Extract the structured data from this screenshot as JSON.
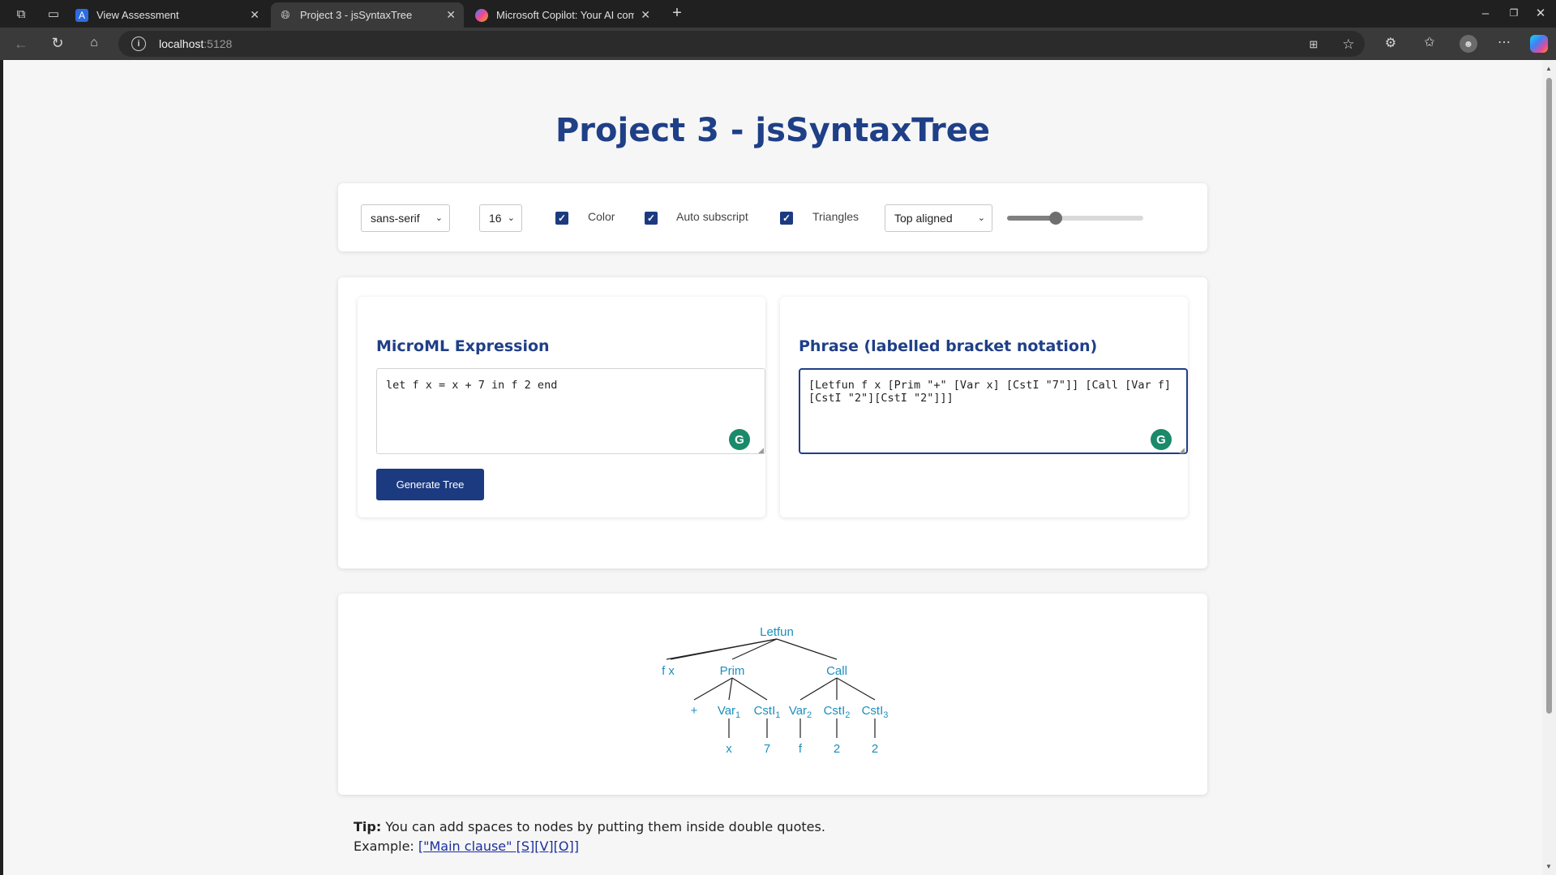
{
  "browser": {
    "tabs": [
      {
        "title": "View Assessment",
        "icon": "assessment-favicon"
      },
      {
        "title": "Project 3 - jsSyntaxTree",
        "icon": "globe-icon"
      },
      {
        "title": "Microsoft Copilot: Your AI com",
        "icon": "copilot-favicon"
      }
    ],
    "address": {
      "host": "localhost",
      "port": ":5128"
    }
  },
  "page": {
    "title": "Project 3 - jsSyntaxTree",
    "options": {
      "font_family": "sans-serif",
      "font_size": "16",
      "color_label": "Color",
      "color_checked": true,
      "auto_subscript_label": "Auto subscript",
      "auto_subscript_checked": true,
      "triangles_label": "Triangles",
      "triangles_checked": true,
      "alignment": "Top aligned",
      "slider_value": 0.36
    },
    "microml": {
      "title": "MicroML Expression",
      "value": "let f x = x + 7 in f 2 end",
      "button": "Generate Tree"
    },
    "phrase": {
      "title": "Phrase (labelled bracket notation)",
      "value": "[Letfun f x [Prim \"+\" [Var x] [CstI \"7\"]] [Call [Var f] [CstI \"2\"][CstI \"2\"]]]"
    },
    "tree": {
      "color": "#1c8fbd",
      "nodes": {
        "root": "Letfun",
        "fx": "f x",
        "prim": "Prim",
        "call": "Call",
        "plus": "+",
        "var1": "Var",
        "var1_sub": "1",
        "csti1": "CstI",
        "csti1_sub": "1",
        "var2": "Var",
        "var2_sub": "2",
        "csti2": "CstI",
        "csti2_sub": "2",
        "csti3": "CstI",
        "csti3_sub": "3",
        "leaf_x": "x",
        "leaf_7": "7",
        "leaf_f": "f",
        "leaf_2a": "2",
        "leaf_2b": "2"
      }
    },
    "tip": {
      "bold": "Tip:",
      "text": " You can add spaces to nodes by putting them inside double quotes.",
      "example_label": "Example: ",
      "example_link": "[\"Main clause\" [S][V][O]]"
    }
  }
}
